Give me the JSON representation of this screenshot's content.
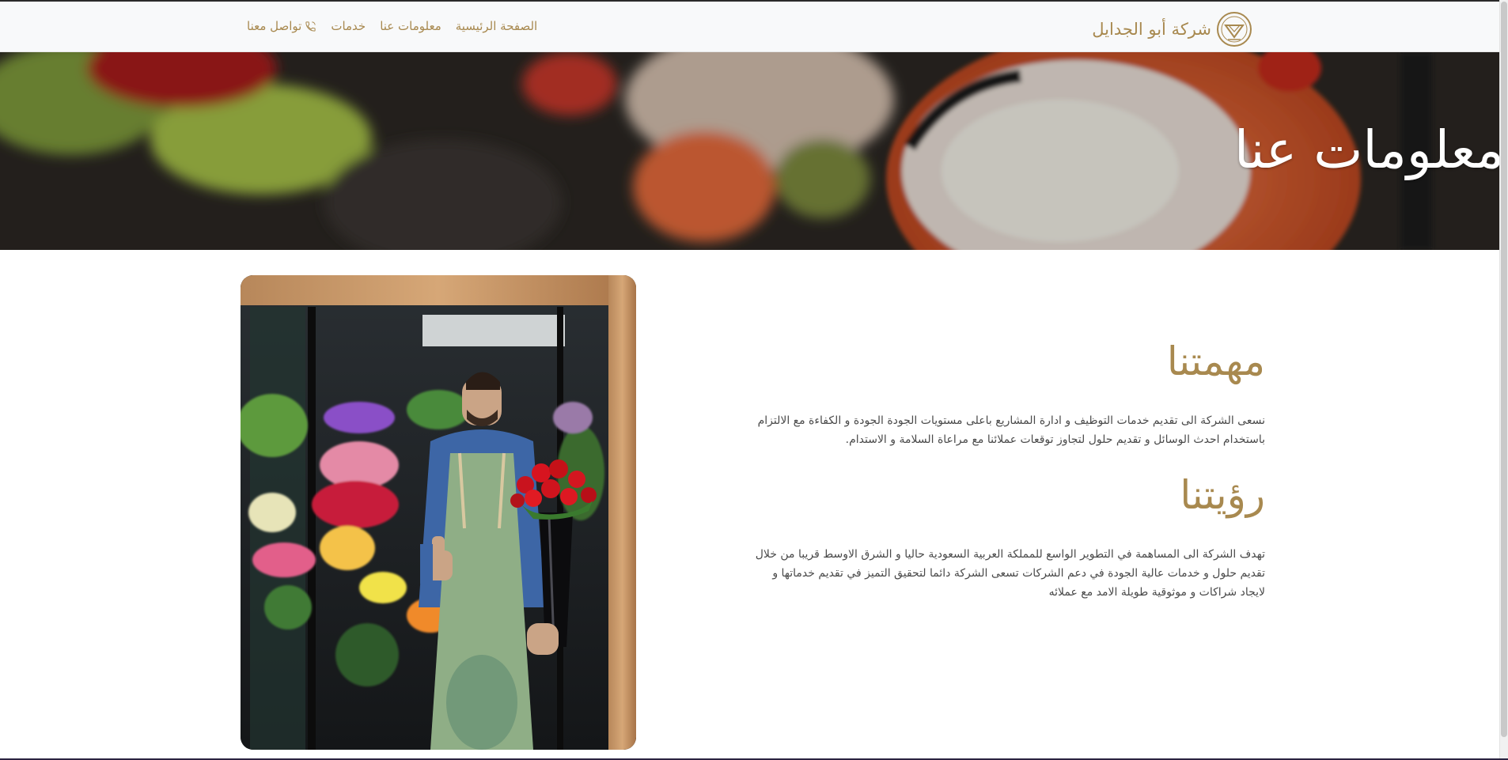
{
  "navbar": {
    "brand_name": "شركة أبو الجدايل",
    "links": [
      {
        "label": "الصفحة الرئيسية"
      },
      {
        "label": "معلومات عنا"
      },
      {
        "label": "خدمات"
      },
      {
        "label": "تواصل معنا",
        "icon": "phone-icon"
      }
    ]
  },
  "hero": {
    "title": "معلومات عنا"
  },
  "mission": {
    "heading": "مهمتنا",
    "text": "نسعى الشركة الى تقديم خدمات التوظيف و ادارة المشاريع باعلى مستويات الجودة الجودة و الكفاءة مع الالتزام باستخدام احدث الوسائل و تقديم حلول لتجاوز توقعات عملائنا مع مراعاة السلامة و الاستدام."
  },
  "vision": {
    "heading": "رؤيتنا",
    "text": "تهدف الشركة الى المساهمة في التطوير الواسع للمملكة العربية السعودية حاليا و الشرق الاوسط قريبا من خلال تقديم حلول و خدمات عالية الجودة في دعم الشركات تسعى الشركة دائما لتحقيق التميز في تقديم خدماتها و لايجاد شراكات و موثوقية طويلة الامد مع عملائه"
  },
  "colors": {
    "accent": "#a8894f",
    "navbar_bg": "#f8f9fa",
    "text": "#4a4a4a"
  }
}
